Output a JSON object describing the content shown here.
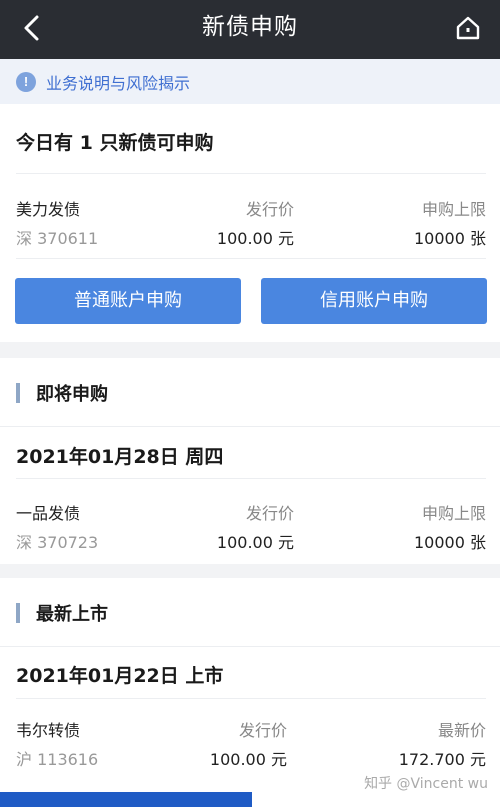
{
  "header": {
    "title": "新债申购",
    "back_icon": "chevron-left-icon",
    "home_icon": "home-icon"
  },
  "notice": {
    "icon": "info-icon",
    "icon_glyph": "!",
    "text": "业务说明与风险揭示"
  },
  "today": {
    "headline": "今日有 1 只新债可申购",
    "bond": {
      "name": "美力发债",
      "code": "深 370611",
      "price_label": "发行价",
      "price": "100.00 元",
      "limit_label": "申购上限",
      "limit": "10000 张"
    },
    "buttons": {
      "normal": "普通账户申购",
      "credit": "信用账户申购"
    }
  },
  "upcoming": {
    "title": "即将申购",
    "date": "2021年01月28日 周四",
    "bond": {
      "name": "一品发债",
      "code": "深 370723",
      "price_label": "发行价",
      "price": "100.00 元",
      "limit_label": "申购上限",
      "limit": "10000 张"
    }
  },
  "listed": {
    "title": "最新上市",
    "date": "2021年01月22日 上市",
    "bond": {
      "name": "韦尔转债",
      "code": "沪 113616",
      "price_label": "发行价",
      "price": "100.00 元",
      "latest_label": "最新价",
      "latest": "172.700 元"
    }
  },
  "watermark": "知乎 @Vincent wu",
  "colors": {
    "header_bg": "#2a2d33",
    "accent_blue": "#4a86e0",
    "notice_text": "#3f6fd1",
    "section_bar": "#8fa7c6"
  }
}
